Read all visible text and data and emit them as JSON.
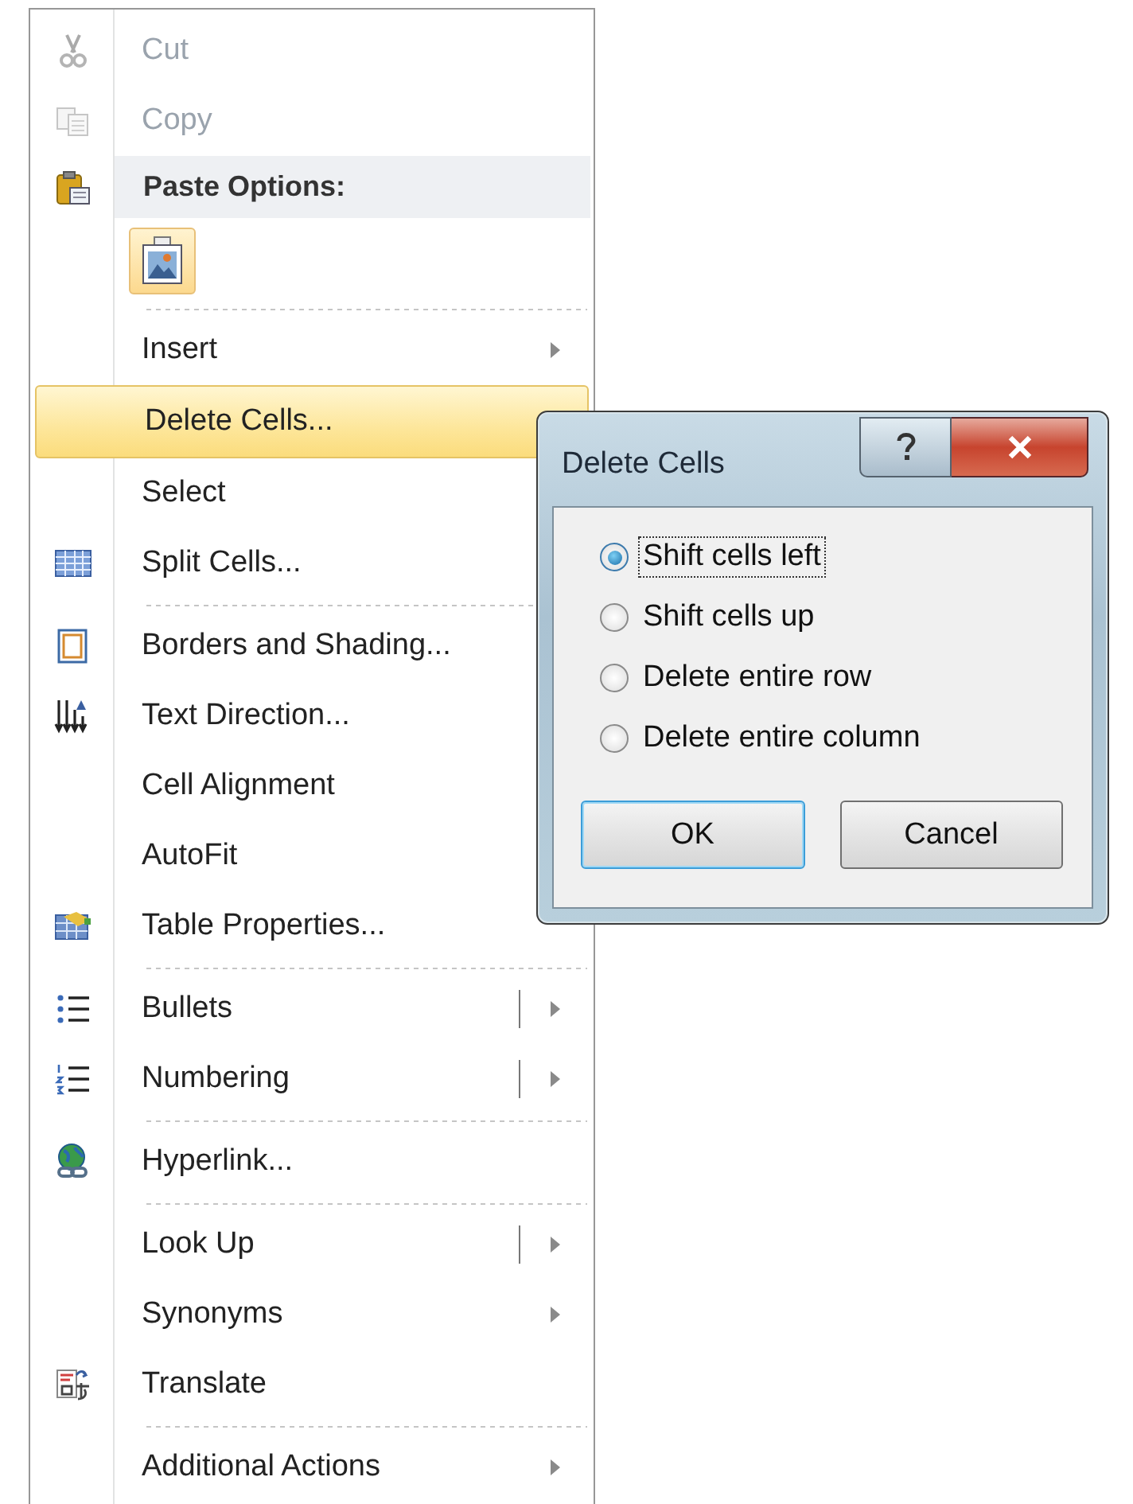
{
  "context_menu": {
    "items": [
      {
        "kind": "command",
        "label": "Cut",
        "disabled": true,
        "selected": false,
        "has_submenu": false,
        "split": false
      },
      {
        "kind": "command",
        "label": "Copy",
        "disabled": true,
        "selected": false,
        "has_submenu": false,
        "split": false
      },
      {
        "kind": "header",
        "label": "Paste Options:"
      },
      {
        "kind": "paste_options"
      },
      {
        "kind": "separator"
      },
      {
        "kind": "command",
        "label": "Insert",
        "disabled": false,
        "selected": false,
        "has_submenu": true,
        "split": false
      },
      {
        "kind": "command",
        "label": "Delete Cells...",
        "disabled": false,
        "selected": true,
        "has_submenu": false,
        "split": false
      },
      {
        "kind": "command",
        "label": "Select",
        "disabled": false,
        "selected": false,
        "split": false
      },
      {
        "kind": "command",
        "label": "Split Cells...",
        "disabled": false,
        "selected": false,
        "split": false
      },
      {
        "kind": "separator"
      },
      {
        "kind": "command",
        "label": "Borders and Shading...",
        "disabled": false,
        "selected": false,
        "split": false
      },
      {
        "kind": "command",
        "label": "Text Direction...",
        "disabled": false,
        "selected": false,
        "split": false
      },
      {
        "kind": "command",
        "label": "Cell Alignment",
        "disabled": false,
        "selected": false,
        "split": false
      },
      {
        "kind": "command",
        "label": "AutoFit",
        "disabled": false,
        "selected": false,
        "split": false
      },
      {
        "kind": "command",
        "label": "Table Properties...",
        "disabled": false,
        "selected": false,
        "has_submenu": false,
        "split": false
      },
      {
        "kind": "separator"
      },
      {
        "kind": "command",
        "label": "Bullets",
        "disabled": false,
        "selected": false,
        "has_submenu": true,
        "split": true
      },
      {
        "kind": "command",
        "label": "Numbering",
        "disabled": false,
        "selected": false,
        "has_submenu": true,
        "split": true
      },
      {
        "kind": "separator"
      },
      {
        "kind": "command",
        "label": "Hyperlink...",
        "disabled": false,
        "selected": false,
        "has_submenu": false,
        "split": false
      },
      {
        "kind": "separator"
      },
      {
        "kind": "command",
        "label": "Look Up",
        "disabled": false,
        "selected": false,
        "has_submenu": true,
        "split": true
      },
      {
        "kind": "command",
        "label": "Synonyms",
        "disabled": false,
        "selected": false,
        "has_submenu": true,
        "split": false
      },
      {
        "kind": "command",
        "label": "Translate",
        "disabled": false,
        "selected": false,
        "has_submenu": false,
        "split": false
      },
      {
        "kind": "separator"
      },
      {
        "kind": "command",
        "label": "Additional Actions",
        "disabled": false,
        "selected": false,
        "has_submenu": true,
        "split": false
      }
    ]
  },
  "dialog": {
    "title": "Delete Cells",
    "options": [
      {
        "label": "Shift cells left",
        "selected": true,
        "focused": true
      },
      {
        "label": "Shift cells up",
        "selected": false,
        "focused": false
      },
      {
        "label": "Delete entire row",
        "selected": false,
        "focused": false
      },
      {
        "label": "Delete entire column",
        "selected": false,
        "focused": false
      }
    ],
    "buttons": [
      {
        "label": "OK",
        "default": true
      },
      {
        "label": "Cancel",
        "default": false
      }
    ]
  }
}
